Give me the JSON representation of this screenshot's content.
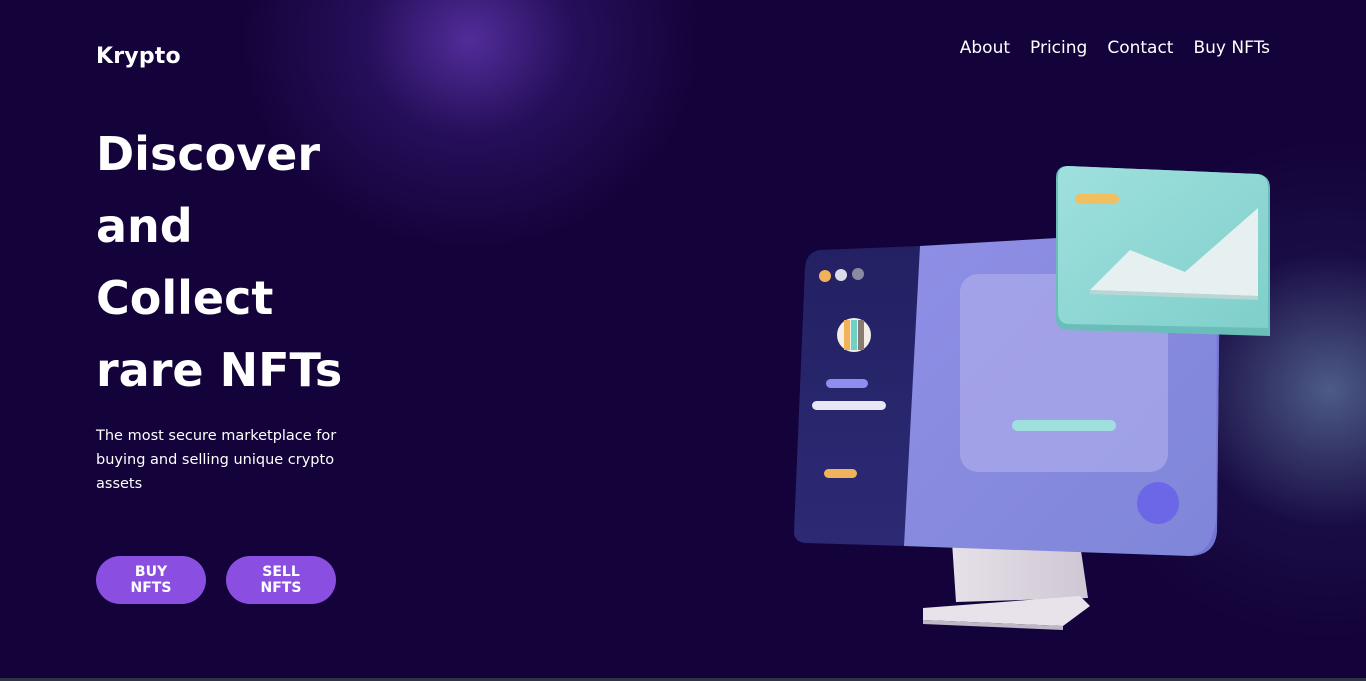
{
  "brand": {
    "name": "Krypto"
  },
  "nav": {
    "items": [
      {
        "label": "About"
      },
      {
        "label": "Pricing"
      },
      {
        "label": "Contact"
      },
      {
        "label": "Buy NFTs"
      }
    ]
  },
  "hero": {
    "headline_lines": [
      "Discover",
      "and",
      "Collect",
      "rare NFTs"
    ],
    "subtitle": "The most secure marketplace for buying and selling unique crypto assets",
    "buy_button": "BUY NFTS",
    "sell_button": "SELL NFTS"
  },
  "theme": {
    "background": "#14033a",
    "accent": "#8a4fe0",
    "glow": "#5c34aa"
  },
  "illustration": {
    "icon": "computer-monitor-nft-illustration"
  }
}
